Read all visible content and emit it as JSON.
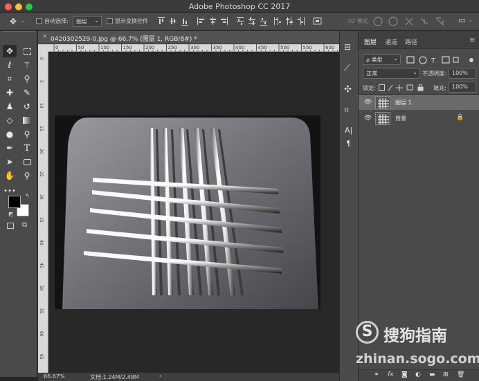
{
  "window": {
    "title": "Adobe Photoshop CC 2017"
  },
  "options_bar": {
    "auto_select_label": "自动选择:",
    "auto_select_value": "图层",
    "show_transform_label": "显示变换控件",
    "mode_label": "3D 模式:"
  },
  "document": {
    "tab_label": "0420302529-0.jpg @ 66.7% (图层 1, RGB/8#) *",
    "ruler_marks": [
      "0",
      "50",
      "100",
      "150",
      "200",
      "250",
      "300",
      "350",
      "400",
      "450",
      "500",
      "550",
      "600",
      "650"
    ],
    "vruler_marks": [
      "0",
      "5",
      "10",
      "15",
      "20",
      "25",
      "30",
      "35",
      "40",
      "45",
      "50",
      "55",
      "60",
      "65"
    ],
    "zoom": "66.67%",
    "doc_size": "文档:1.24M/2.48M"
  },
  "layers_panel": {
    "tabs": [
      "图层",
      "通道",
      "路径"
    ],
    "filter_kind": "ρ 类型",
    "blend_mode": "正常",
    "opacity_label": "不透明度:",
    "opacity_value": "100%",
    "lock_label": "锁定:",
    "fill_label": "填充:",
    "fill_value": "100%",
    "layers": [
      {
        "name": "图层 1",
        "selected": true,
        "locked": false
      },
      {
        "name": "背景",
        "selected": false,
        "locked": true
      }
    ]
  },
  "watermark": {
    "brand": "搜狗指南",
    "url": "zhinan.sogo.com"
  }
}
